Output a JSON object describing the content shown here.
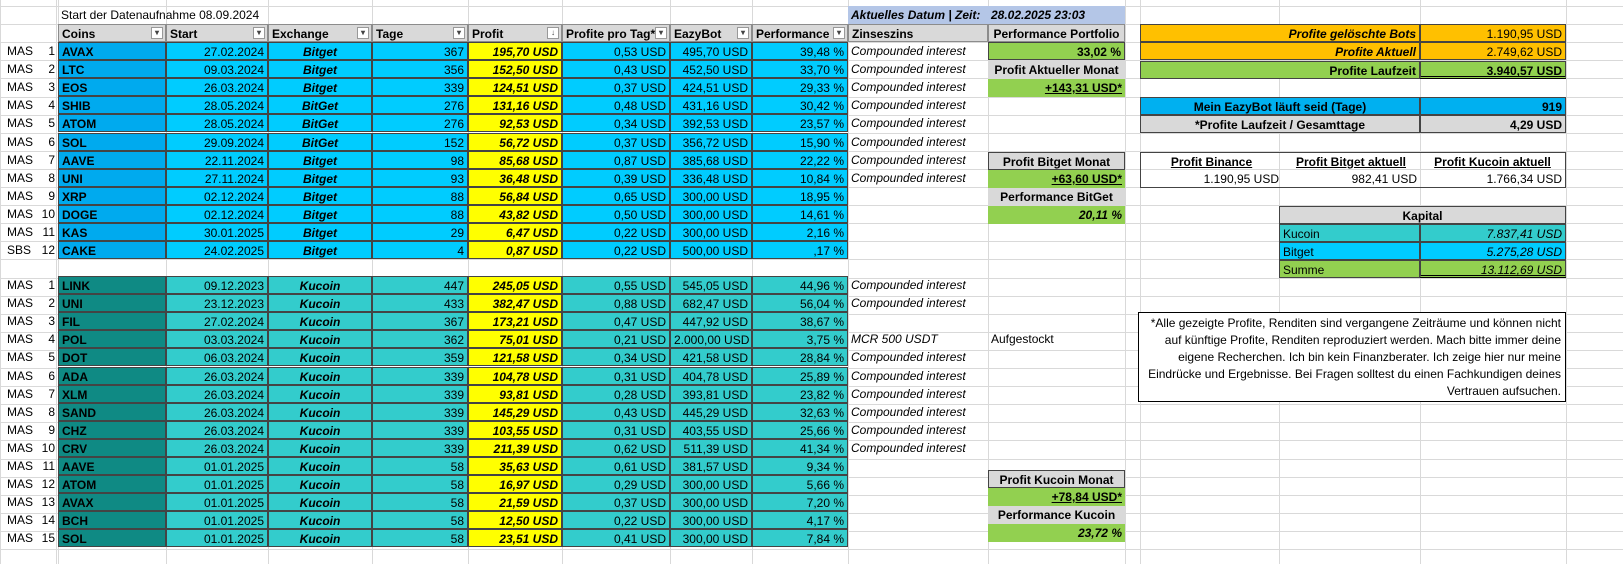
{
  "title": "Start der Datenaufnahme 08.09.2024",
  "date_label": "Aktuelles Datum | Zeit:",
  "date_value": "28.02.2025 23:03",
  "headers": [
    "Coins",
    "Start",
    "Exchange",
    "Tage",
    "Profit",
    "Profite pro Tag*",
    "EazyBot",
    "Performance",
    "Zinseszins"
  ],
  "bitget_rows": [
    {
      "tag": "MAS",
      "n": "1",
      "coin": "AVAX",
      "start": "27.02.2024",
      "ex": "Bitget",
      "tage": "367",
      "profit": "195,70 USD",
      "ppt": "0,53 USD",
      "eazy": "495,70 USD",
      "perf": "39,48 %",
      "zins": "Compounded interest"
    },
    {
      "tag": "MAS",
      "n": "2",
      "coin": "LTC",
      "start": "09.03.2024",
      "ex": "Bitget",
      "tage": "356",
      "profit": "152,50 USD",
      "ppt": "0,43 USD",
      "eazy": "452,50 USD",
      "perf": "33,70 %",
      "zins": "Compounded interest"
    },
    {
      "tag": "MAS",
      "n": "3",
      "coin": "EOS",
      "start": "26.03.2024",
      "ex": "Bitget",
      "tage": "339",
      "profit": "124,51 USD",
      "ppt": "0,37 USD",
      "eazy": "424,51 USD",
      "perf": "29,33 %",
      "zins": "Compounded interest"
    },
    {
      "tag": "MAS",
      "n": "4",
      "coin": "SHIB",
      "start": "28.05.2024",
      "ex": "BitGet",
      "tage": "276",
      "profit": "131,16 USD",
      "ppt": "0,48 USD",
      "eazy": "431,16 USD",
      "perf": "30,42 %",
      "zins": "Compounded interest"
    },
    {
      "tag": "MAS",
      "n": "5",
      "coin": "ATOM",
      "start": "28.05.2024",
      "ex": "BitGet",
      "tage": "276",
      "profit": "92,53 USD",
      "ppt": "0,34 USD",
      "eazy": "392,53 USD",
      "perf": "23,57 %",
      "zins": "Compounded interest"
    },
    {
      "tag": "MAS",
      "n": "6",
      "coin": "SOL",
      "start": "29.09.2024",
      "ex": "BitGet",
      "tage": "152",
      "profit": "56,72 USD",
      "ppt": "0,37 USD",
      "eazy": "356,72 USD",
      "perf": "15,90 %",
      "zins": "Compounded interest"
    },
    {
      "tag": "MAS",
      "n": "7",
      "coin": "AAVE",
      "start": "22.11.2024",
      "ex": "Bitget",
      "tage": "98",
      "profit": "85,68 USD",
      "ppt": "0,87 USD",
      "eazy": "385,68 USD",
      "perf": "22,22 %",
      "zins": "Compounded interest"
    },
    {
      "tag": "MAS",
      "n": "8",
      "coin": "UNI",
      "start": "27.11.2024",
      "ex": "Bitget",
      "tage": "93",
      "profit": "36,48 USD",
      "ppt": "0,39 USD",
      "eazy": "336,48 USD",
      "perf": "10,84 %",
      "zins": "Compounded interest"
    },
    {
      "tag": "MAS",
      "n": "9",
      "coin": "XRP",
      "start": "02.12.2024",
      "ex": "Bitget",
      "tage": "88",
      "profit": "56,84 USD",
      "ppt": "0,65 USD",
      "eazy": "300,00 USD",
      "perf": "18,95 %",
      "zins": ""
    },
    {
      "tag": "MAS",
      "n": "10",
      "coin": "DOGE",
      "start": "02.12.2024",
      "ex": "Bitget",
      "tage": "88",
      "profit": "43,82 USD",
      "ppt": "0,50 USD",
      "eazy": "300,00 USD",
      "perf": "14,61 %",
      "zins": ""
    },
    {
      "tag": "MAS",
      "n": "11",
      "coin": "KAS",
      "start": "30.01.2025",
      "ex": "Bitget",
      "tage": "29",
      "profit": "6,47 USD",
      "ppt": "0,22 USD",
      "eazy": "300,00 USD",
      "perf": "2,16 %",
      "zins": ""
    },
    {
      "tag": "SBS",
      "n": "12",
      "coin": "CAKE",
      "start": "24.02.2025",
      "ex": "Bitget",
      "tage": "4",
      "profit": "0,87 USD",
      "ppt": "0,22 USD",
      "eazy": "500,00 USD",
      "perf": ",17 %",
      "zins": ""
    }
  ],
  "kucoin_rows": [
    {
      "tag": "MAS",
      "n": "1",
      "coin": "LINK",
      "start": "09.12.2023",
      "ex": "Kucoin",
      "tage": "447",
      "profit": "245,05 USD",
      "ppt": "0,55 USD",
      "eazy": "545,05 USD",
      "perf": "44,96 %",
      "zins": "Compounded interest"
    },
    {
      "tag": "MAS",
      "n": "2",
      "coin": "UNI",
      "start": "23.12.2023",
      "ex": "Kucoin",
      "tage": "433",
      "profit": "382,47 USD",
      "ppt": "0,88 USD",
      "eazy": "682,47 USD",
      "perf": "56,04 %",
      "zins": "Compounded interest"
    },
    {
      "tag": "MAS",
      "n": "3",
      "coin": "FIL",
      "start": "27.02.2024",
      "ex": "Kucoin",
      "tage": "367",
      "profit": "173,21 USD",
      "ppt": "0,47 USD",
      "eazy": "447,92 USD",
      "perf": "38,67 %",
      "zins": ""
    },
    {
      "tag": "MAS",
      "n": "4",
      "coin": "POL",
      "start": "03.03.2024",
      "ex": "Kucoin",
      "tage": "362",
      "profit": "75,01 USD",
      "ppt": "0,21 USD",
      "eazy": "2.000,00 USD",
      "perf": "3,75 %",
      "zins": "MCR 500 USDT"
    },
    {
      "tag": "MAS",
      "n": "5",
      "coin": "DOT",
      "start": "06.03.2024",
      "ex": "Kucoin",
      "tage": "359",
      "profit": "121,58 USD",
      "ppt": "0,34 USD",
      "eazy": "421,58 USD",
      "perf": "28,84 %",
      "zins": "Compounded interest"
    },
    {
      "tag": "MAS",
      "n": "6",
      "coin": "ADA",
      "start": "26.03.2024",
      "ex": "Kucoin",
      "tage": "339",
      "profit": "104,78 USD",
      "ppt": "0,31 USD",
      "eazy": "404,78 USD",
      "perf": "25,89 %",
      "zins": "Compounded interest"
    },
    {
      "tag": "MAS",
      "n": "7",
      "coin": "XLM",
      "start": "26.03.2024",
      "ex": "Kucoin",
      "tage": "339",
      "profit": "93,81 USD",
      "ppt": "0,28 USD",
      "eazy": "393,81 USD",
      "perf": "23,82 %",
      "zins": "Compounded interest"
    },
    {
      "tag": "MAS",
      "n": "8",
      "coin": "SAND",
      "start": "26.03.2024",
      "ex": "Kucoin",
      "tage": "339",
      "profit": "145,29 USD",
      "ppt": "0,43 USD",
      "eazy": "445,29 USD",
      "perf": "32,63 %",
      "zins": "Compounded interest"
    },
    {
      "tag": "MAS",
      "n": "9",
      "coin": "CHZ",
      "start": "26.03.2024",
      "ex": "Kucoin",
      "tage": "339",
      "profit": "103,55 USD",
      "ppt": "0,31 USD",
      "eazy": "403,55 USD",
      "perf": "25,66 %",
      "zins": "Compounded interest"
    },
    {
      "tag": "MAS",
      "n": "10",
      "coin": "CRV",
      "start": "26.03.2024",
      "ex": "Kucoin",
      "tage": "339",
      "profit": "211,39 USD",
      "ppt": "0,62 USD",
      "eazy": "511,39 USD",
      "perf": "41,34 %",
      "zins": "Compounded interest"
    },
    {
      "tag": "MAS",
      "n": "11",
      "coin": "AAVE",
      "start": "01.01.2025",
      "ex": "Kucoin",
      "tage": "58",
      "profit": "35,63 USD",
      "ppt": "0,61 USD",
      "eazy": "381,57 USD",
      "perf": "9,34 %",
      "zins": ""
    },
    {
      "tag": "MAS",
      "n": "12",
      "coin": "ATOM",
      "start": "01.01.2025",
      "ex": "Kucoin",
      "tage": "58",
      "profit": "16,97 USD",
      "ppt": "0,29 USD",
      "eazy": "300,00 USD",
      "perf": "5,66 %",
      "zins": ""
    },
    {
      "tag": "MAS",
      "n": "13",
      "coin": "AVAX",
      "start": "01.01.2025",
      "ex": "Kucoin",
      "tage": "58",
      "profit": "21,59 USD",
      "ppt": "0,37 USD",
      "eazy": "300,00 USD",
      "perf": "7,20 %",
      "zins": ""
    },
    {
      "tag": "MAS",
      "n": "14",
      "coin": "BCH",
      "start": "01.01.2025",
      "ex": "Kucoin",
      "tage": "58",
      "profit": "12,50 USD",
      "ppt": "0,22 USD",
      "eazy": "300,00 USD",
      "perf": "4,17 %",
      "zins": ""
    },
    {
      "tag": "MAS",
      "n": "15",
      "coin": "SOL",
      "start": "01.01.2025",
      "ex": "Kucoin",
      "tage": "58",
      "profit": "23,51 USD",
      "ppt": "0,41 USD",
      "eazy": "300,00 USD",
      "perf": "7,84 %",
      "zins": ""
    }
  ],
  "aufgestockt": "Aufgestockt",
  "side": {
    "perf_portfolio_label": "Performance Portfolio",
    "perf_portfolio_value": "33,02 %",
    "profit_month_label": "Profit Aktueller Monat",
    "profit_month_value": "+143,31 USD*",
    "bitget_month_label": "Profit Bitget Monat",
    "bitget_month_value": "+63,60 USD*",
    "bitget_perf_label": "Performance BitGet",
    "bitget_perf_value": "20,11 %",
    "kucoin_month_label": "Profit Kucoin Monat",
    "kucoin_month_value": "+78,84 USD*",
    "kucoin_perf_label": "Performance Kucoin",
    "kucoin_perf_value": "23,72 %"
  },
  "summary": {
    "deleted_label": "Profite gelöschte Bots",
    "deleted_value": "1.190,95 USD",
    "current_label": "Profite Aktuell",
    "current_value": "2.749,62 USD",
    "runtime_label": "Profite Laufzeit",
    "runtime_value": "3.940,57 USD",
    "days_label": "Mein EazyBot läuft seid (Tage)",
    "days_value": "919",
    "avg_label": "*Profite Laufzeit  / Gesamttage",
    "avg_value": "4,29 USD",
    "binance_label": "Profit Binance",
    "binance_value": "1.190,95 USD",
    "bitget_label": "Profit Bitget aktuell",
    "bitget_value": "982,41 USD",
    "kucoin_label": "Profit Kucoin aktuell",
    "kucoin_value": "1.766,34 USD",
    "kapital_label": "Kapital",
    "kap_kucoin_label": "Kucoin",
    "kap_kucoin_value": "7.837,41 USD",
    "kap_bitget_label": "Bitget",
    "kap_bitget_value": "5.275,28 USD",
    "kap_sum_label": "Summe",
    "kap_sum_value": "13.112,69 USD"
  },
  "disclaimer": "*Alle gezeigte Profite, Renditen sind vergangene Zeiträume und können nicht auf künftige Profite, Renditen reproduziert werden. Mach bitte immer deine eigene Recherchen. Ich bin kein Finanzberater. Ich zeige hier nur meine Eindrücke und Ergebnisse. Bei Fragen solltest du einen Fachkundigen deines Vertrauen aufsuchen."
}
